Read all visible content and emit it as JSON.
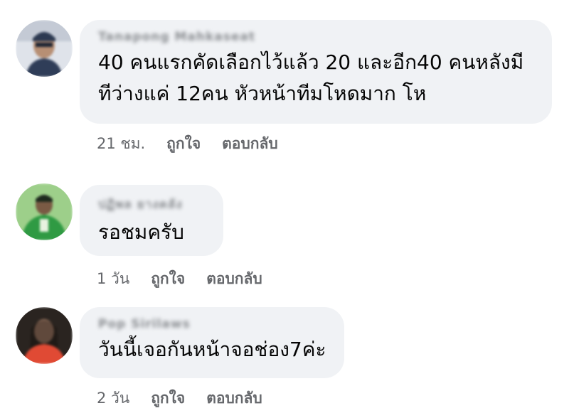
{
  "comments": [
    {
      "author": "Tanapong Mahkaseat",
      "text_lines": [
        "40 คนแรกคัดเลือกไว้แล้ว 20 และอีก40 คนหลังมี",
        "ทีว่างแค่ 12คน  หัวหน้าทีมโหดมาก โห"
      ],
      "time": "21 ชม.",
      "like_label": "ถูกใจ",
      "reply_label": "ตอบกลับ",
      "avatar_color": "#c8ccd6"
    },
    {
      "author": "ปฏิพล ยางคลัง",
      "text_lines": [
        "รอชมครับ"
      ],
      "time": "1 วัน",
      "like_label": "ถูกใจ",
      "reply_label": "ตอบกลับ",
      "avatar_color": "#3fa84a"
    },
    {
      "author": "Pop Sirilaws",
      "text_lines": [
        "วันนี้เจอกันหน้าจอช่อง7ค่ะ"
      ],
      "time": "2 วัน",
      "like_label": "ถูกใจ",
      "reply_label": "ตอบกลับ",
      "avatar_color": "#d9463a"
    }
  ]
}
